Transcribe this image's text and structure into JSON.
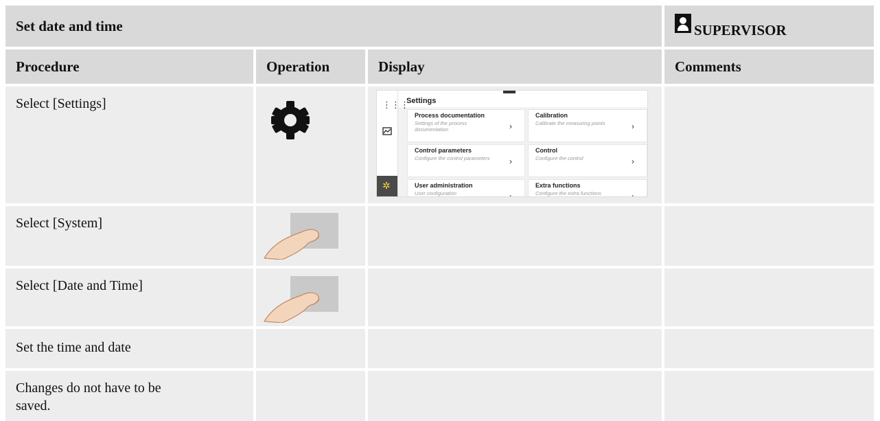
{
  "title": "Set date and time",
  "role": {
    "label": "SUPERVISOR",
    "icon": "user-icon"
  },
  "columns": {
    "procedure": "Procedure",
    "operation": "Operation",
    "display": "Display",
    "comments": "Comments"
  },
  "rows": [
    {
      "procedure": "Select [Settings]",
      "operation_icon": "gear-icon"
    },
    {
      "procedure": "Select [System]",
      "operation_icon": "touch-hand-icon"
    },
    {
      "procedure": "Select [Date and Time]",
      "operation_icon": "touch-hand-icon"
    },
    {
      "procedure": "Set the time and date"
    },
    {
      "procedure": "Changes do not have to be saved."
    }
  ],
  "display_screenshot": {
    "title": "Settings",
    "tiles": [
      {
        "title": "Process documentation",
        "desc": "Settings of the process documentation"
      },
      {
        "title": "Calibration",
        "desc": "Calibrate the measuring points"
      },
      {
        "title": "Control parameters",
        "desc": "Configure the control parameters"
      },
      {
        "title": "Control",
        "desc": "Configure the control"
      },
      {
        "title": "User administration",
        "desc": "User configuration"
      },
      {
        "title": "Extra functions",
        "desc": "Configure the extra functions"
      }
    ],
    "active_accent": "#f4d33a"
  }
}
